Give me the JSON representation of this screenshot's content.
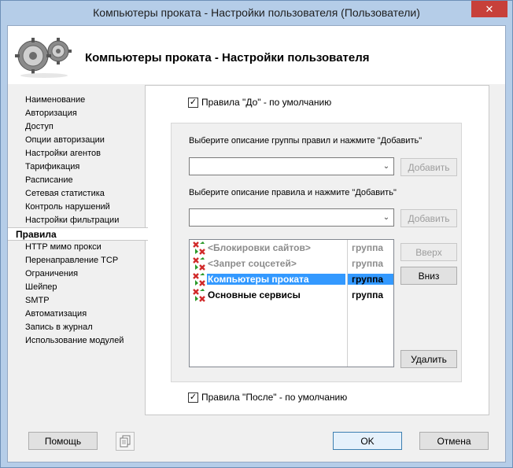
{
  "window": {
    "title": "Компьютеры проката - Настройки пользователя (Пользователи)",
    "close_glyph": "✕"
  },
  "header": {
    "title": "Компьютеры проката - Настройки пользователя",
    "logo_icon": "gears-icon"
  },
  "nav": {
    "items": [
      {
        "label": "Наименование",
        "name": "nav-item-naimenovanie"
      },
      {
        "label": "Авторизация",
        "name": "nav-item-avtorizatsiya"
      },
      {
        "label": "Доступ",
        "name": "nav-item-dostup"
      },
      {
        "label": "Опции авторизации",
        "name": "nav-item-optsii-avtorizatsii"
      },
      {
        "label": "Настройки агентов",
        "name": "nav-item-nastroyki-agentov"
      },
      {
        "label": "Тарификация",
        "name": "nav-item-tarifikatsiya"
      },
      {
        "label": "Расписание",
        "name": "nav-item-raspisanie"
      },
      {
        "label": "Сетевая статистика",
        "name": "nav-item-setevaya-statistika"
      },
      {
        "label": "Контроль нарушений",
        "name": "nav-item-kontrol-narusheniy"
      },
      {
        "label": "Настройки фильтрации",
        "name": "nav-item-nastroyki-filtratsii"
      },
      {
        "label": "Правила",
        "name": "nav-item-pravila",
        "active": true
      },
      {
        "label": "HTTP мимо прокси",
        "name": "nav-item-http-mimo-proksi"
      },
      {
        "label": "Перенаправление TCP",
        "name": "nav-item-perenapravlenie-tcp"
      },
      {
        "label": "Ограничения",
        "name": "nav-item-ogranicheniya"
      },
      {
        "label": "Шейпер",
        "name": "nav-item-sheyper"
      },
      {
        "label": "SMTP",
        "name": "nav-item-smtp"
      },
      {
        "label": "Автоматизация",
        "name": "nav-item-avtomatizatsiya"
      },
      {
        "label": "Запись в журнал",
        "name": "nav-item-zapis-v-zhurnal"
      },
      {
        "label": "Использование модулей",
        "name": "nav-item-ispolzovanie-moduley"
      }
    ]
  },
  "rules_panel": {
    "before_checkbox": {
      "label": "Правила \"До\" - по умолчанию",
      "checked": true
    },
    "after_checkbox": {
      "label": "Правила \"После\" - по умолчанию",
      "checked": true
    },
    "group_prompt": "Выберите описание группы правил и нажмите \"Добавить\"",
    "group_combo_value": "",
    "rule_prompt": "Выберите описание правила и нажмите \"Добавить\"",
    "rule_combo_value": "",
    "add_label": "Добавить",
    "up_label": "Вверх",
    "down_label": "Вниз",
    "delete_label": "Удалить",
    "list": [
      {
        "name": "<Блокировки сайтов>",
        "type": "группа",
        "state": "disabled"
      },
      {
        "name": "<Запрет соцсетей>",
        "type": "группа",
        "state": "disabled"
      },
      {
        "name": "Компьютеры проката",
        "type": "группа",
        "state": "selected"
      },
      {
        "name": "Основные сервисы",
        "type": "группа",
        "state": "normal"
      }
    ]
  },
  "footer": {
    "help_label": "Помощь",
    "copy_icon": "copy-document-icon",
    "ok_label": "OK",
    "cancel_label": "Отмена"
  },
  "colors": {
    "selection": "#3399ff",
    "window_frame": "#b5cde8",
    "close_button": "#c7403a",
    "rule_icon_red": "#d12a2a",
    "rule_icon_green": "#2a9a2a"
  }
}
